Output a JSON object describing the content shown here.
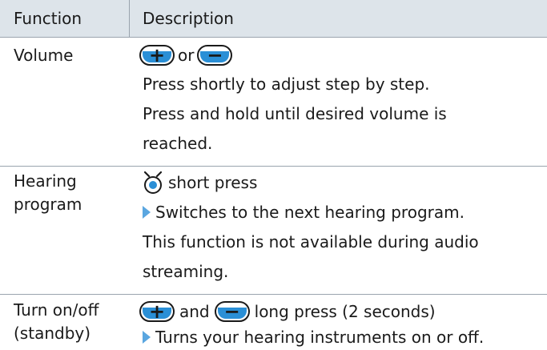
{
  "header": {
    "function": "Function",
    "description": "Description"
  },
  "rows": [
    {
      "function_lines": [
        "Volume"
      ],
      "or_text": "or",
      "lines": [
        "Press shortly to adjust step by step.",
        "Press and hold until desired volume is",
        "reached."
      ]
    },
    {
      "function_lines": [
        "Hearing",
        "program"
      ],
      "button_action": "short press",
      "result": "Switches to the next hearing program.",
      "lines": [
        "This function is not available during audio",
        "streaming."
      ]
    },
    {
      "function_lines": [
        "Turn on/off",
        "(standby)"
      ],
      "and_text": "and",
      "action": "long press (2 seconds)",
      "result": "Turns your hearing instruments on or off."
    }
  ],
  "icons": {
    "plus": "+",
    "minus": "−",
    "arrow": "play-arrow-icon",
    "program_button": "program-button-icon"
  },
  "colors": {
    "header_bg": "#dde4ea",
    "accent_blue": "#2a8fd6",
    "arrow_blue": "#5aa6e0",
    "rule": "#9aa4ae"
  }
}
